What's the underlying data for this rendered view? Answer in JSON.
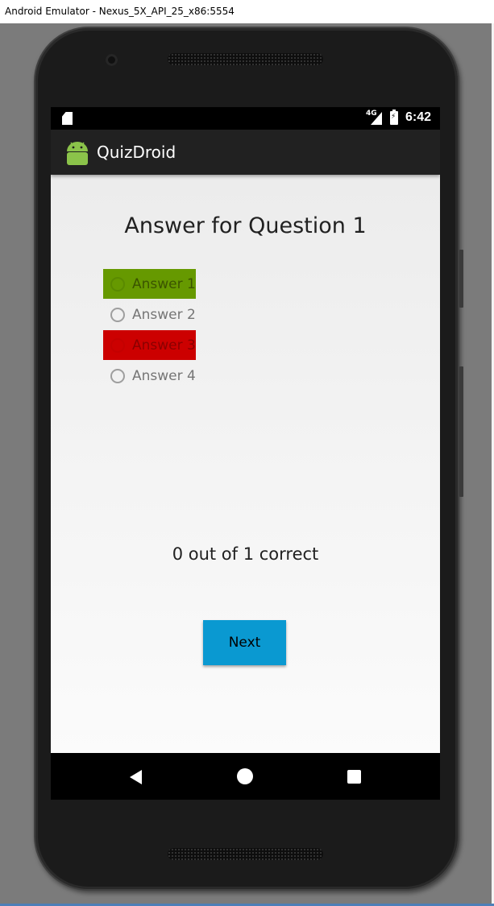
{
  "window": {
    "title": "Android Emulator - Nexus_5X_API_25_x86:5554"
  },
  "status_bar": {
    "network_label": "4G",
    "time": "6:42",
    "icons": [
      "sd-card-icon",
      "signal-icon",
      "battery-icon"
    ]
  },
  "app_bar": {
    "title": "QuizDroid",
    "icon": "android-icon"
  },
  "quiz": {
    "title": "Answer for Question 1",
    "answers": [
      {
        "label": "Answer 1",
        "highlight": "#669900",
        "state": "correct"
      },
      {
        "label": "Answer 2",
        "highlight": "",
        "state": "none"
      },
      {
        "label": "Answer 3",
        "highlight": "#cc0000",
        "state": "selected-wrong"
      },
      {
        "label": "Answer 4",
        "highlight": "",
        "state": "none"
      }
    ],
    "score_text": "0 out of 1 correct",
    "next_label": "Next"
  },
  "nav_bar": {
    "icons": [
      "back-icon",
      "home-icon",
      "recents-icon"
    ]
  },
  "colors": {
    "accent": "#0a99d1",
    "correct": "#669900",
    "wrong": "#cc0000",
    "app_bar": "#212121"
  }
}
